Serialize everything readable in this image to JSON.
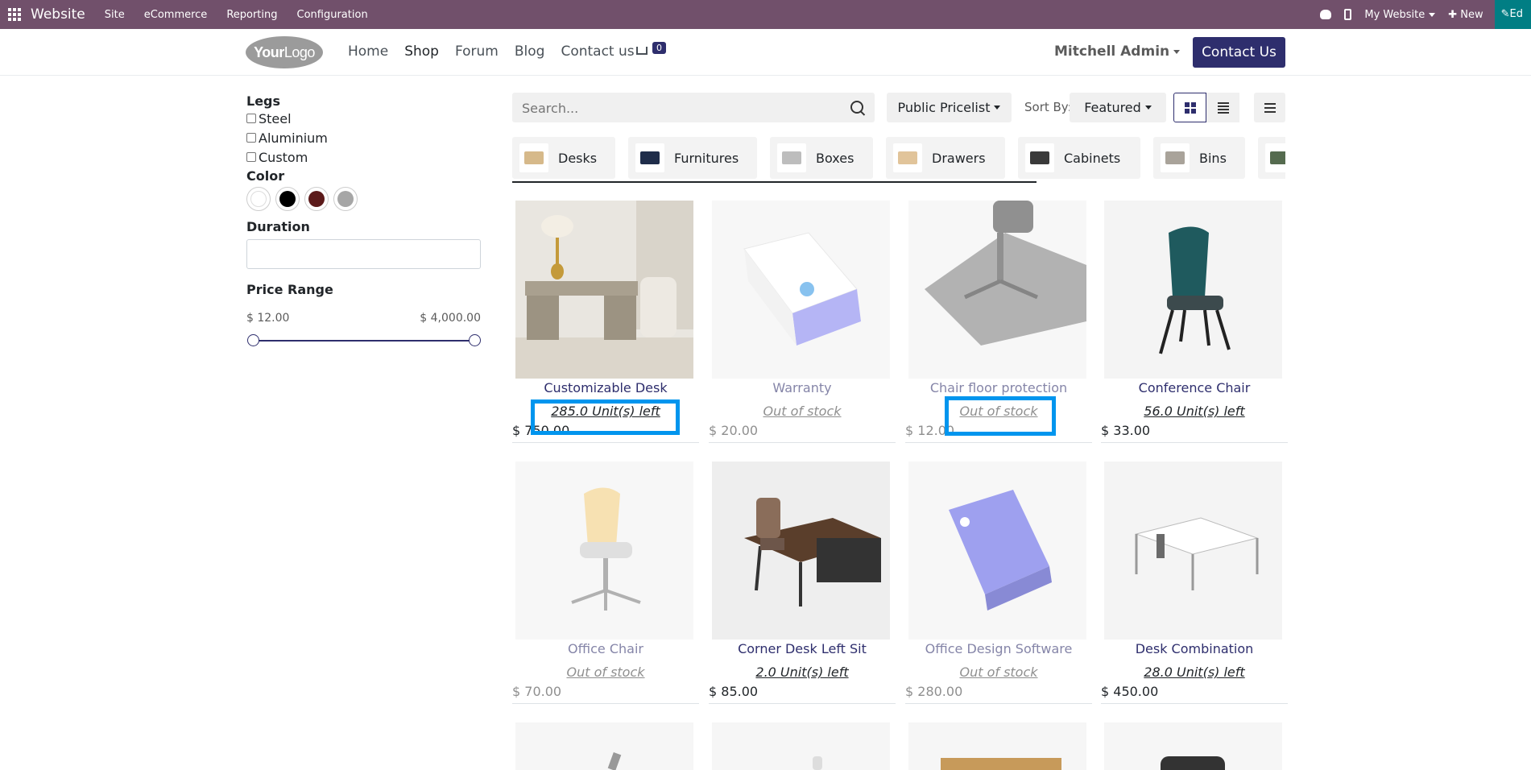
{
  "adminbar": {
    "brand": "Website",
    "menus": [
      "Site",
      "eCommerce",
      "Reporting",
      "Configuration"
    ],
    "website_switcher": "My Website",
    "new_label": "New",
    "edit_label": "Ed"
  },
  "header": {
    "logo_main": "Your",
    "logo_sub": "Logo",
    "nav": [
      "Home",
      "Shop",
      "Forum",
      "Blog",
      "Contact us"
    ],
    "cart_count": "0",
    "user": "Mitchell Admin",
    "contact_button": "Contact Us"
  },
  "sidebar": {
    "legs_title": "Legs",
    "legs_options": [
      "Steel",
      "Aluminium",
      "Custom"
    ],
    "color_title": "Color",
    "colors": [
      "#ffffff",
      "#000000",
      "#5b1a1a",
      "#a6a6a6"
    ],
    "duration_title": "Duration",
    "price_title": "Price Range",
    "price_min": "$ 12.00",
    "price_max": "$ 4,000.00"
  },
  "controls": {
    "search_placeholder": "Search...",
    "pricelist": "Public Pricelist",
    "sort_label": "Sort By:",
    "sort_value": "Featured"
  },
  "categories": [
    {
      "label": "Desks",
      "color": "#d6b98a"
    },
    {
      "label": "Furnitures",
      "color": "#1f2d4a"
    },
    {
      "label": "Boxes",
      "color": "#bdbdbd"
    },
    {
      "label": "Drawers",
      "color": "#e1c49a"
    },
    {
      "label": "Cabinets",
      "color": "#3a3a3a"
    },
    {
      "label": "Bins",
      "color": "#a9a39a"
    },
    {
      "label": "",
      "color": "#556b4f"
    }
  ],
  "products": [
    {
      "name": "Customizable Desk",
      "stock": "285.0 Unit(s) left",
      "price": "$ 750.00"
    },
    {
      "name": "Warranty",
      "stock": "Out of stock",
      "price": "$ 20.00"
    },
    {
      "name": "Chair floor protection",
      "stock": "Out of stock",
      "price": "$ 12.00"
    },
    {
      "name": "Conference Chair",
      "stock": "56.0 Unit(s) left",
      "price": "$ 33.00"
    },
    {
      "name": "Office Chair",
      "stock": "Out of stock",
      "price": "$ 70.00"
    },
    {
      "name": "Corner Desk Left Sit",
      "stock": "2.0 Unit(s) left",
      "price": "$ 85.00"
    },
    {
      "name": "Office Design Software",
      "stock": "Out of stock",
      "price": "$ 280.00"
    },
    {
      "name": "Desk Combination",
      "stock": "28.0 Unit(s) left",
      "price": "$ 450.00"
    }
  ],
  "colors": {
    "admin_bar": "#71506b",
    "primary": "#2e2e6d",
    "highlight": "#0095ee"
  }
}
